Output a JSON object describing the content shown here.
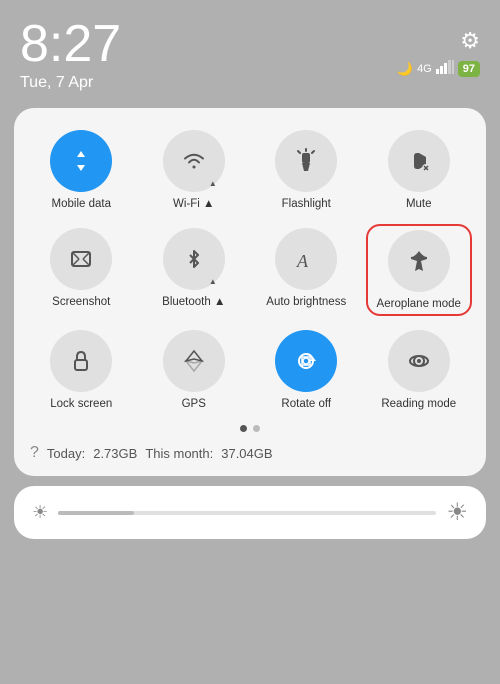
{
  "statusBar": {
    "time": "8:27",
    "date": "Tue, 7 Apr",
    "batteryLabel": "97",
    "gearLabel": "⚙"
  },
  "quickPanel": {
    "tiles": [
      {
        "id": "mobile-data",
        "label": "Mobile data",
        "icon": "mobile",
        "active": true
      },
      {
        "id": "wifi",
        "label": "Wi-Fi ▲",
        "icon": "wifi",
        "active": false
      },
      {
        "id": "flashlight",
        "label": "Flashlight",
        "icon": "flashlight",
        "active": false
      },
      {
        "id": "mute",
        "label": "Mute",
        "icon": "bell",
        "active": false
      },
      {
        "id": "screenshot",
        "label": "Screenshot",
        "icon": "screenshot",
        "active": false
      },
      {
        "id": "bluetooth",
        "label": "Bluetooth ▲",
        "icon": "bluetooth",
        "active": false
      },
      {
        "id": "auto-brightness",
        "label": "Auto brightness",
        "icon": "text-a",
        "active": false
      },
      {
        "id": "aeroplane-mode",
        "label": "Aeroplane mode",
        "icon": "plane",
        "active": false,
        "highlighted": true
      },
      {
        "id": "lock-screen",
        "label": "Lock screen",
        "icon": "lock",
        "active": false
      },
      {
        "id": "gps",
        "label": "GPS",
        "icon": "gps",
        "active": false
      },
      {
        "id": "rotate-off",
        "label": "Rotate off",
        "icon": "rotate",
        "active": true
      },
      {
        "id": "reading-mode",
        "label": "Reading mode",
        "icon": "eye",
        "active": false
      }
    ],
    "dots": [
      {
        "active": true
      },
      {
        "active": false
      }
    ],
    "dataRow": {
      "todayLabel": "Today:",
      "todayValue": "2.73GB",
      "monthLabel": "This month:",
      "monthValue": "37.04GB"
    }
  },
  "brightnessBar": {
    "leftIcon": "☀",
    "rightIcon": "☀"
  }
}
